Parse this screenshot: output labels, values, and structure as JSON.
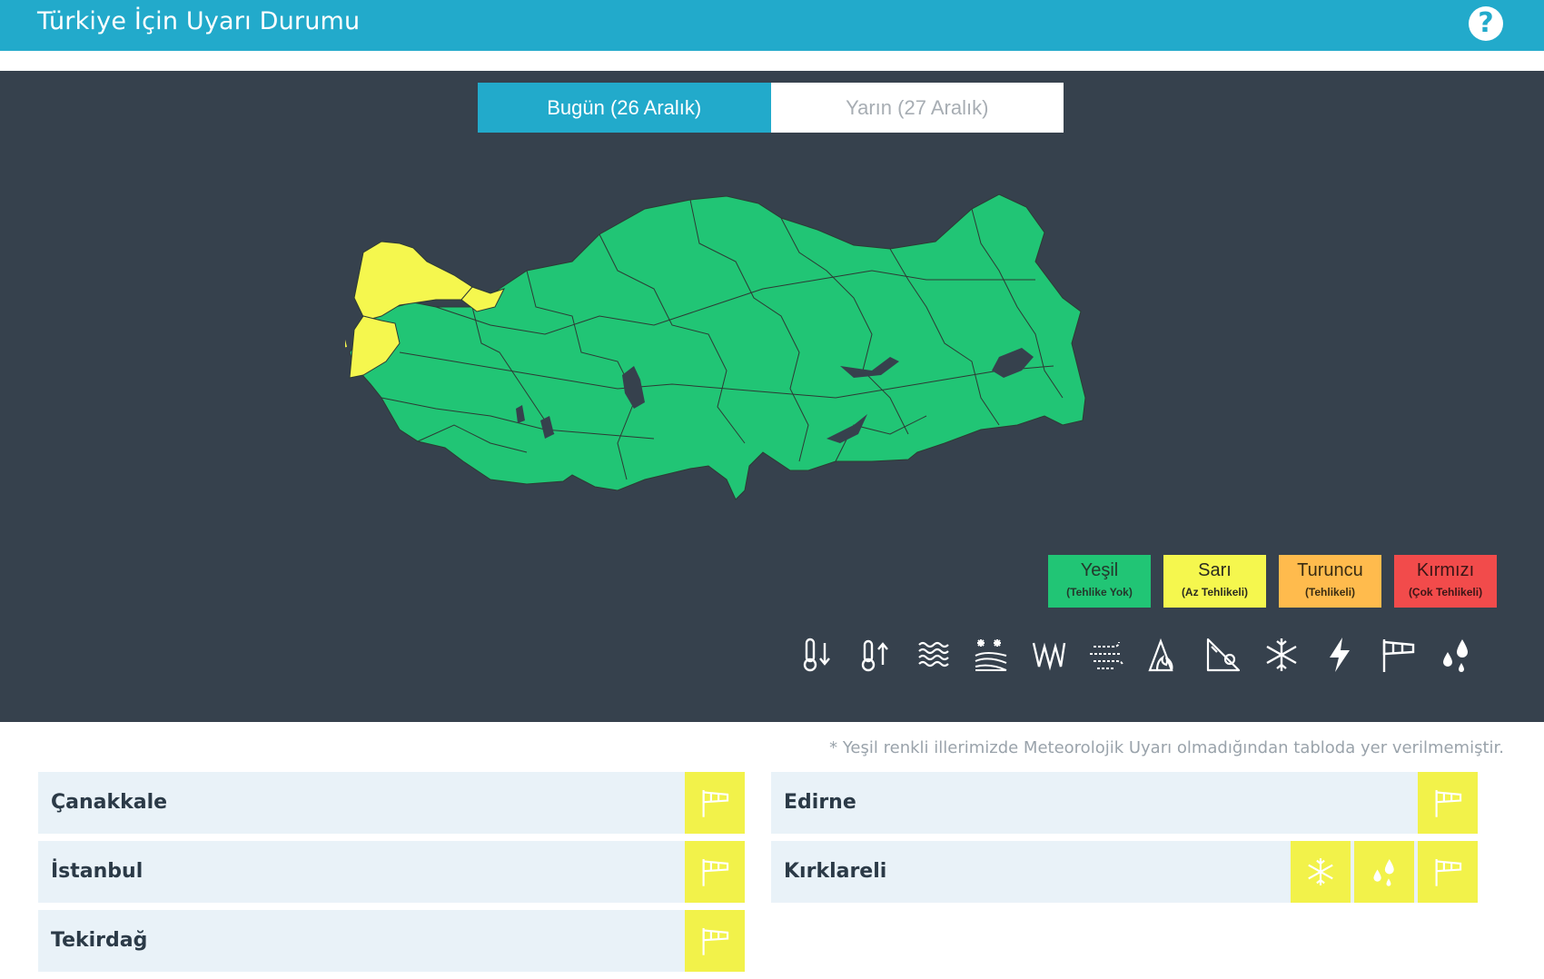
{
  "header": {
    "title": "Türkiye İçin Uyarı Durumu",
    "help_icon": "question-circle-icon"
  },
  "tabs": [
    {
      "label": "Bugün (26 Aralık)",
      "active": true
    },
    {
      "label": "Yarın (27 Aralık)",
      "active": false
    }
  ],
  "colors": {
    "header": "#22aacb",
    "stage": "#36414d",
    "green": "#21c575",
    "yellow": "#f5f74e",
    "orange": "#ffbb4d",
    "red": "#f24b4b"
  },
  "legend": [
    {
      "name": "Yeşil",
      "sub": "(Tehlike Yok)",
      "color": "#21c575"
    },
    {
      "name": "Sarı",
      "sub": "(Az Tehlikeli)",
      "color": "#f5f74e"
    },
    {
      "name": "Turuncu",
      "sub": "(Tehlikeli)",
      "color": "#ffbb4d"
    },
    {
      "name": "Kırmızı",
      "sub": "(Çok Tehlikeli)",
      "color": "#f24b4b"
    }
  ],
  "hazard_icons": [
    "cold-thermometer-icon",
    "hot-thermometer-icon",
    "fog-icon",
    "snowfall-icon",
    "avalanche-icon",
    "dust-wind-icon",
    "forest-fire-icon",
    "landslide-icon",
    "snowflake-icon",
    "lightning-icon",
    "wind-flag-icon",
    "rain-drops-icon"
  ],
  "note": "* Yeşil renkli illerimizde Meteorolojik Uyarı olmadığından tabloda yer verilmemiştir.",
  "provinces": {
    "left": [
      {
        "name": "Çanakkale",
        "warnings": [
          "wind-flag-icon"
        ]
      },
      {
        "name": "İstanbul",
        "warnings": [
          "wind-flag-icon"
        ]
      },
      {
        "name": "Tekirdağ",
        "warnings": [
          "wind-flag-icon"
        ]
      }
    ],
    "right": [
      {
        "name": "Edirne",
        "warnings": [
          "wind-flag-icon"
        ]
      },
      {
        "name": "Kırklareli",
        "warnings": [
          "snowflake-icon",
          "rain-drops-icon",
          "wind-flag-icon"
        ]
      }
    ]
  }
}
